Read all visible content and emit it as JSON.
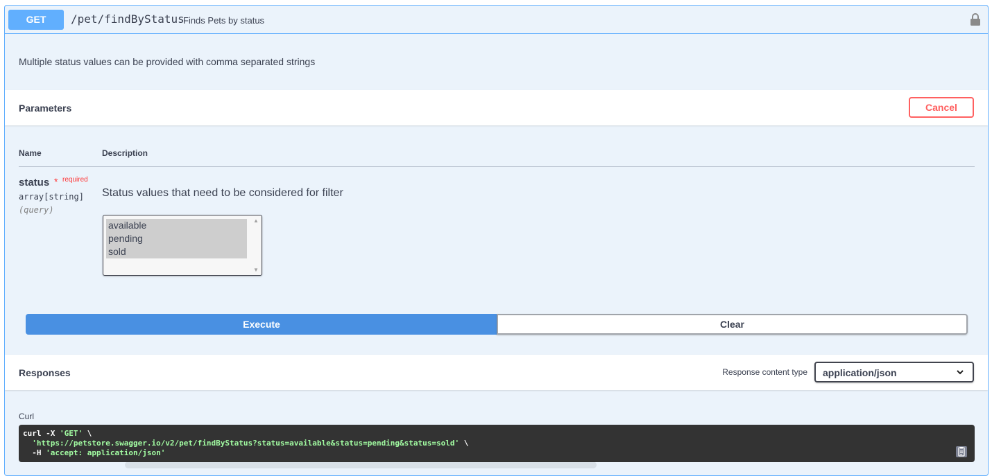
{
  "operation": {
    "method": "GET",
    "path": "/pet/findByStatus",
    "summary": "Finds Pets by status",
    "description": "Multiple status values can be provided with comma separated strings"
  },
  "parameters": {
    "title": "Parameters",
    "cancel_label": "Cancel",
    "col_name": "Name",
    "col_description": "Description",
    "param": {
      "name": "status",
      "required_star": "*",
      "required_label": "required",
      "type": "array[string]",
      "in": "(query)",
      "description": "Status values that need to be considered for filter",
      "options": [
        "available",
        "pending",
        "sold"
      ]
    }
  },
  "actions": {
    "execute_label": "Execute",
    "clear_label": "Clear"
  },
  "responses": {
    "title": "Responses",
    "content_type_label": "Response content type",
    "content_type_value": "application/json"
  },
  "curl": {
    "label": "Curl",
    "line1_cmd": "curl -X ",
    "line1_method": "'GET'",
    "line1_cont": " \\",
    "line2_url": "'https://petstore.swagger.io/v2/pet/findByStatus?status=available&status=pending&status=sold'",
    "line2_cont": " \\",
    "line3_flag": "  -H ",
    "line3_header": "'accept: application/json'"
  },
  "colors": {
    "get_accent": "#61affe",
    "execute_blue": "#4990e2",
    "cancel_red": "#ff6060",
    "curl_bg": "#333333",
    "curl_string": "#a2fca2"
  },
  "icons": {
    "lock": "lock-icon",
    "chevron": "chevron-down-icon",
    "copy": "copy-to-clipboard-icon"
  }
}
